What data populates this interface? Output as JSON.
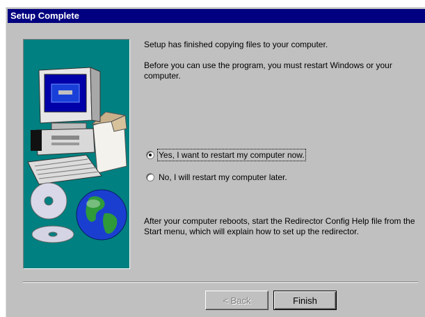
{
  "dialog": {
    "title": "Setup Complete"
  },
  "content": {
    "line1": "Setup has finished copying files to your computer.",
    "line2": "Before you can use the program, you must restart Windows or your computer.",
    "footer": "After your computer reboots, start the Redirector Config Help file from the Start menu, which will explain how to set up the redirector."
  },
  "options": [
    {
      "label": "Yes, I want to restart my computer now.",
      "checked": true
    },
    {
      "label": "No, I will restart my computer later.",
      "checked": false
    }
  ],
  "buttons": {
    "back": {
      "label": "< Back",
      "enabled": false
    },
    "finish": {
      "label": "Finish",
      "enabled": true
    }
  },
  "illustration": {
    "icons": [
      "computer-icon",
      "monitor-icon",
      "keyboard-icon",
      "box-icon",
      "cd-icon",
      "globe-icon"
    ],
    "background_color": "#008080"
  }
}
